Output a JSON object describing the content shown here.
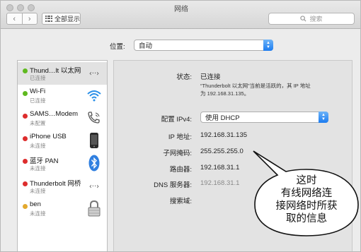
{
  "window": {
    "title": "网络"
  },
  "toolbar": {
    "back": "‹",
    "forward": "›",
    "show_all": "全部显示",
    "search_placeholder": "搜索",
    "search_icon": "magnifier-icon"
  },
  "location": {
    "label": "位置:",
    "value": "自动"
  },
  "services": [
    {
      "name": "Thund…lt 以太网",
      "status": "已连接",
      "color": "#5fb91f",
      "icon": "ethernet-arrows-icon",
      "selected": true
    },
    {
      "name": "Wi-Fi",
      "status": "已连接",
      "color": "#5fb91f",
      "icon": "wifi-icon"
    },
    {
      "name": "SAMS…Modem",
      "status": "未配置",
      "color": "#dd2d2d",
      "icon": "phone-modem-icon"
    },
    {
      "name": "iPhone USB",
      "status": "未连接",
      "color": "#dd2d2d",
      "icon": "iphone-icon"
    },
    {
      "name": "蓝牙 PAN",
      "status": "未连接",
      "color": "#dd2d2d",
      "icon": "bluetooth-icon"
    },
    {
      "name": "Thunderbolt 网桥",
      "status": "未连接",
      "color": "#dd2d2d",
      "icon": "bridge-arrows-icon"
    },
    {
      "name": "ben",
      "status": "未连接",
      "color": "#e3a92e",
      "icon": "lock-icon"
    }
  ],
  "detail": {
    "status_label": "状态:",
    "status_value": "已连接",
    "status_note_1": "“Thunderbolt 以太网”当前是活跃的，其 IP 地址",
    "status_note_2": "为 192.168.31.135。",
    "config_label": "配置 IPv4:",
    "config_value": "使用 DHCP",
    "ip_label": "IP 地址:",
    "ip_value": "192.168.31.135",
    "subnet_label": "子网掩码:",
    "subnet_value": "255.255.255.0",
    "router_label": "路由器:",
    "router_value": "192.168.31.1",
    "dns_label": "DNS 服务器:",
    "dns_value": "192.168.31.1",
    "search_domain_label": "搜索域:"
  },
  "callout": {
    "line1": "这时",
    "line2": "有线网络连",
    "line3": "接网络时所获",
    "line4": "取的信息"
  }
}
